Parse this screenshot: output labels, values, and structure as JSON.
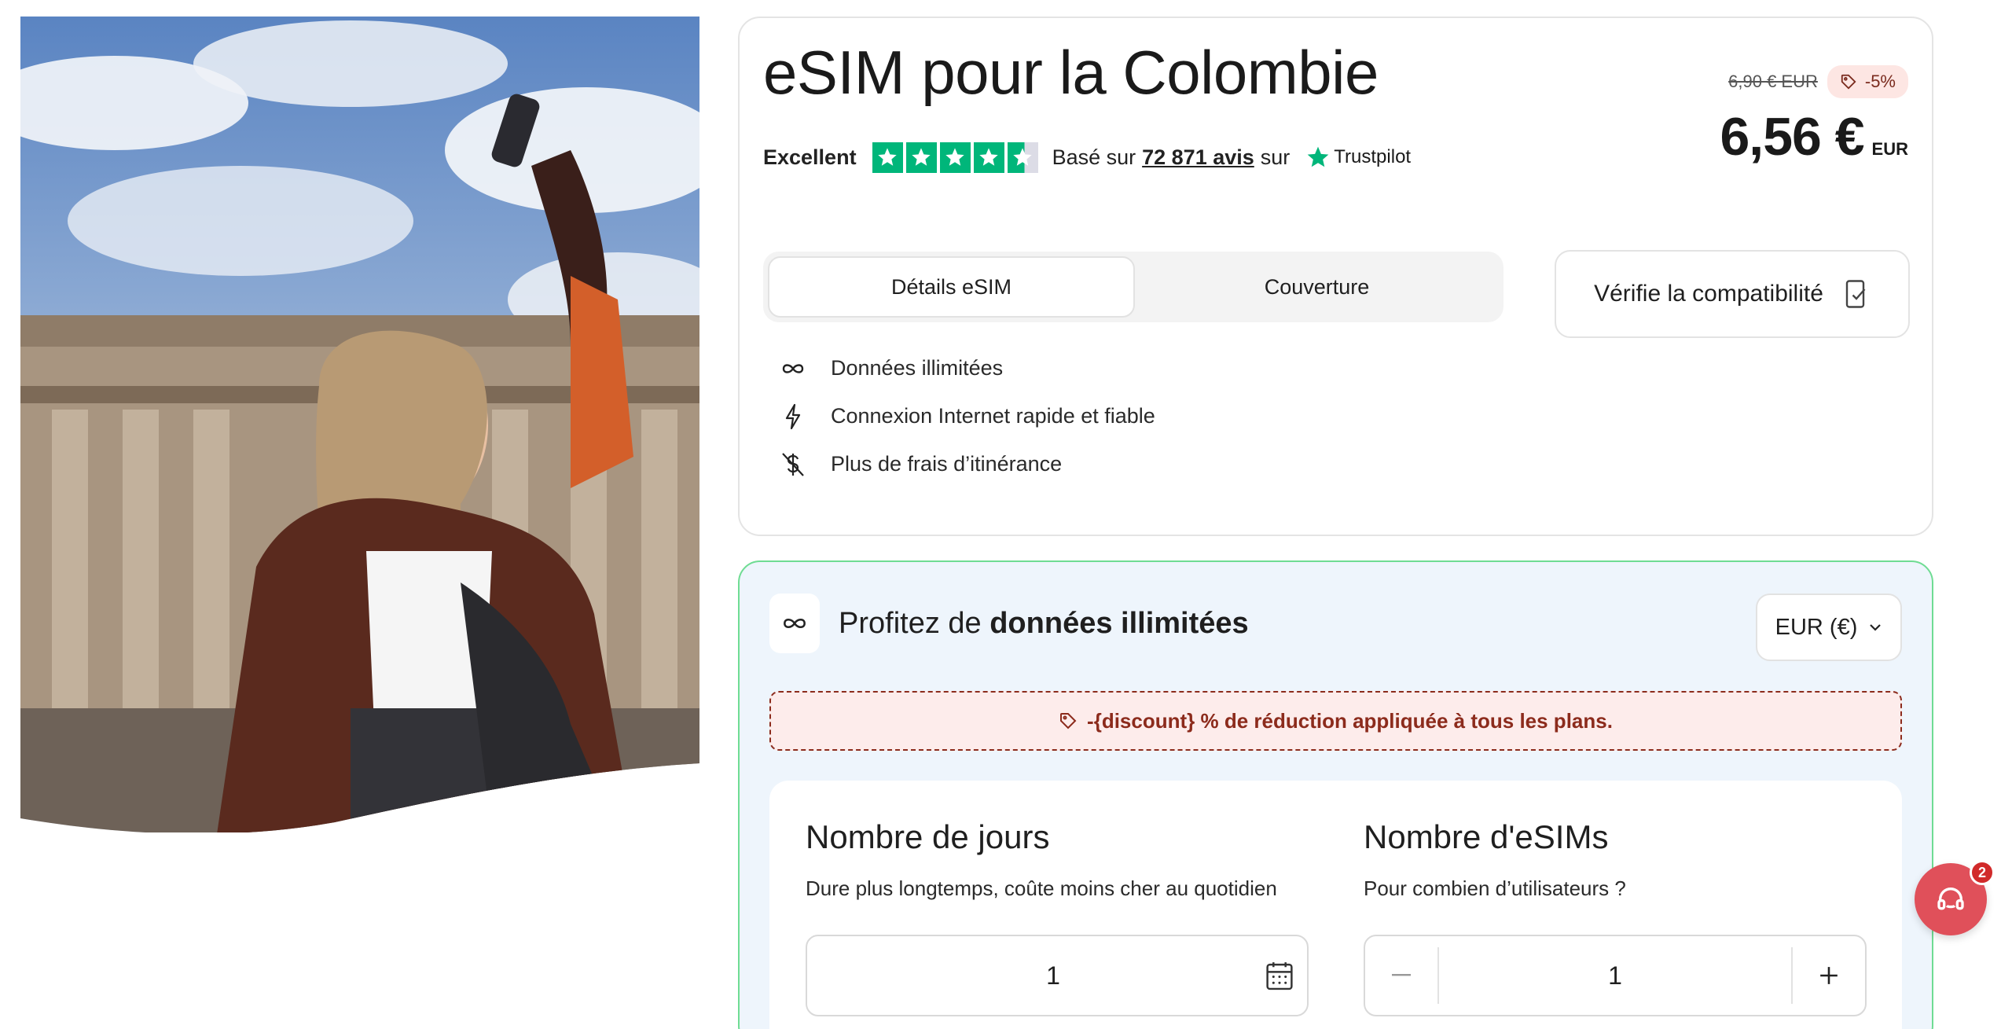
{
  "product": {
    "title": "eSIM pour la Colombie",
    "rating_label": "Excellent",
    "based_on": "Basé sur",
    "review_count": "72 871 avis",
    "on": "sur",
    "trustpilot": "Trustpilot",
    "stars": 4.5
  },
  "price": {
    "old": "6,90 € EUR",
    "discount": "-5%",
    "current": "6,56 €",
    "currency": "EUR"
  },
  "tabs": [
    {
      "label": "Détails eSIM",
      "active": true
    },
    {
      "label": "Couverture",
      "active": false
    }
  ],
  "compat_button": "Vérifie la compatibilité",
  "features": [
    {
      "icon": "infinity-icon",
      "label": "Données illimitées"
    },
    {
      "icon": "lightning-icon",
      "label": "Connexion Internet rapide et fiable"
    },
    {
      "icon": "no-dollar-icon",
      "label": "Plus de frais d’itinérance"
    }
  ],
  "plans": {
    "title_prefix": "Profitez de",
    "title_bold": "données illimitées",
    "currency_select": "EUR (€)",
    "banner": "-{discount} % de réduction appliquée à tous les plans.",
    "days": {
      "heading": "Nombre de jours",
      "subtitle": "Dure plus longtemps, coûte moins cher au quotidien",
      "value": "1"
    },
    "esims": {
      "heading": "Nombre d'eSIMs",
      "subtitle": "Pour combien d’utilisateurs ?",
      "value": "1"
    }
  },
  "chat": {
    "badge": "2"
  },
  "colors": {
    "trustpilot_green": "#00b67a",
    "discount_red": "#8c2b1c",
    "plans_border": "#6fdc93",
    "chat": "#e0505a"
  }
}
